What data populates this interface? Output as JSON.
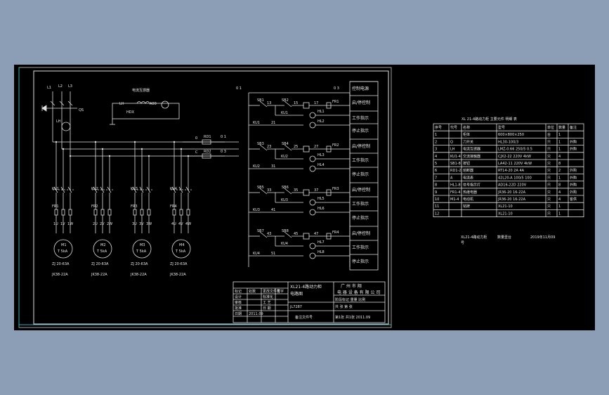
{
  "schematic": {
    "lines": [
      "L1",
      "L2",
      "L3"
    ],
    "qs": "QS",
    "lh": "LH",
    "meter_title": "电流互感器",
    "meter_parts": [
      "LH",
      "A00",
      "HDX"
    ],
    "fuses": [
      "RD1",
      "RD2"
    ],
    "fuse_left": [
      "0",
      "C"
    ],
    "fuse_right": [
      "0 1",
      "0 3"
    ],
    "motors": [
      {
        "km": "KU1",
        "fr": "FR1",
        "tags": [
          "1U",
          "1V",
          "1W"
        ],
        "m": "M1",
        "kw": "T 5kA",
        "spec1": "ZJ 20-63A",
        "spec2": "JK38-22A"
      },
      {
        "km": "KU2",
        "fr": "FR2",
        "tags": [
          "2U",
          "2V",
          "2W"
        ],
        "m": "M2",
        "kw": "T 5kA",
        "spec1": "ZJ 20-63A",
        "spec2": "JK38-22A"
      },
      {
        "km": "KU3",
        "fr": "FR3",
        "tags": [
          "3U",
          "3V",
          "3W"
        ],
        "m": "M3",
        "kw": "T 5kA",
        "spec1": "ZJ 20-63A",
        "spec2": "JK38-22A"
      },
      {
        "km": "KU4",
        "fr": "FR4",
        "tags": [
          "4U",
          "4V",
          "4W"
        ],
        "m": "M4",
        "kw": "T 5kA",
        "spec1": "ZJ 20-63A",
        "spec2": "JK38-22A"
      }
    ],
    "ctrl": {
      "top_left": "0 1",
      "top_right": "0 3",
      "groups": [
        {
          "sb_a": "SB1",
          "sb_b": "SB2",
          "km": "KU1",
          "fr": "FR1",
          "hl_a": "HL1",
          "hl_b": "HL2",
          "nums": [
            "13",
            "15",
            "17",
            "11",
            "21"
          ]
        },
        {
          "sb_a": "SB3",
          "sb_b": "SB4",
          "km": "KU2",
          "fr": "FR2",
          "hl_a": "HL3",
          "hl_b": "HL4",
          "nums": [
            "23",
            "25",
            "27",
            "21",
            "31"
          ]
        },
        {
          "sb_a": "SB5",
          "sb_b": "SB6",
          "km": "KU3",
          "fr": "FR3",
          "hl_a": "HL5",
          "hl_b": "HL6",
          "nums": [
            "33",
            "35",
            "37",
            "31",
            "41"
          ]
        },
        {
          "sb_a": "SB7",
          "sb_b": "SB8",
          "km": "KU4",
          "fr": "FR4",
          "hl_a": "HL7",
          "hl_b": "HL8",
          "nums": [
            "43",
            "45",
            "47",
            "41",
            "51"
          ]
        }
      ],
      "legend": [
        "控制电源",
        "启/停控制",
        "工作指示",
        "停止指示",
        "启/停控制",
        "工作指示",
        "停止指示",
        "启/停控制",
        "工作指示",
        "停止指示",
        "启/停控制",
        "工作指示",
        "停止指示"
      ]
    },
    "title_block": {
      "left_rows": [
        [
          "标记",
          "处数",
          "更改文件号",
          "签字",
          "日期"
        ],
        [
          "设计",
          "",
          "标准化",
          "",
          ""
        ],
        [
          "审核",
          "",
          "工 艺",
          "",
          ""
        ],
        [
          "批准",
          "",
          "日 期",
          "",
          ""
        ],
        [
          "日期",
          "2011.09",
          "",
          "",
          ""
        ]
      ],
      "drawing_name": "XL21-4路动力柜",
      "drawing_sub": "电路图",
      "drawing_no": "JL7287",
      "company_1": "广 州 市 翔",
      "company_2": "电 器 设 备 有 限 公 司",
      "stage": "阶段标记",
      "weight": "重量",
      "scale": "比例",
      "sheet": "共 张 第 张",
      "bottom_mid": "备注文件号",
      "bottom_right": "第1张 共1张 2011.09"
    }
  },
  "table": {
    "title": "XL 21-4路动力柜 主要元件 明细 表",
    "headers": [
      "序号",
      "代号",
      "名称",
      "型号",
      "单位",
      "数量",
      "备注"
    ],
    "rows": [
      [
        "1",
        "",
        "柜体",
        "600×800×250",
        "台",
        "1",
        ""
      ],
      [
        "2",
        "Q",
        "刀开关",
        "HL30-100/3",
        "只",
        "1",
        "外购"
      ],
      [
        "3",
        "LH",
        "电流互感器",
        "LMZ-0.66 250/5 0.5",
        "只",
        "1",
        "外购"
      ],
      [
        "4",
        "KU1-4",
        "交流接触器",
        "CJX2-22 220V 4kW",
        "只",
        "4",
        ""
      ],
      [
        "5",
        "SB1-8",
        "按钮",
        "LA42-11 220V 4kW",
        "只",
        "8",
        ""
      ],
      [
        "6",
        "RD1-2",
        "熔断器",
        "RT14-20 2A 4A",
        "只",
        "2",
        "外购"
      ],
      [
        "7",
        "A",
        "电流表",
        "42L20-A 100/5 100",
        "只",
        "1",
        "外购"
      ],
      [
        "8",
        "HL1-8",
        "信号指示灯",
        "AD16-22D 220V",
        "只",
        "8",
        "外购"
      ],
      [
        "9",
        "FR1-4",
        "热继电器",
        "JR36-20 16-22A",
        "只",
        "4",
        "外购"
      ],
      [
        "10",
        "M1-4",
        "电动机",
        "JR36-20 16-22A",
        "只",
        "4",
        "客供"
      ],
      [
        "11",
        "",
        "铭牌",
        "XL21-10",
        "只",
        "1",
        ""
      ],
      [
        "12",
        "",
        "",
        "XL21-10",
        "只",
        "1",
        ""
      ]
    ],
    "footer_1": "XL21-4路动力柜",
    "footer_2": "数量壹台",
    "footer_3": "2019年11月09",
    "footer_4": "号"
  }
}
